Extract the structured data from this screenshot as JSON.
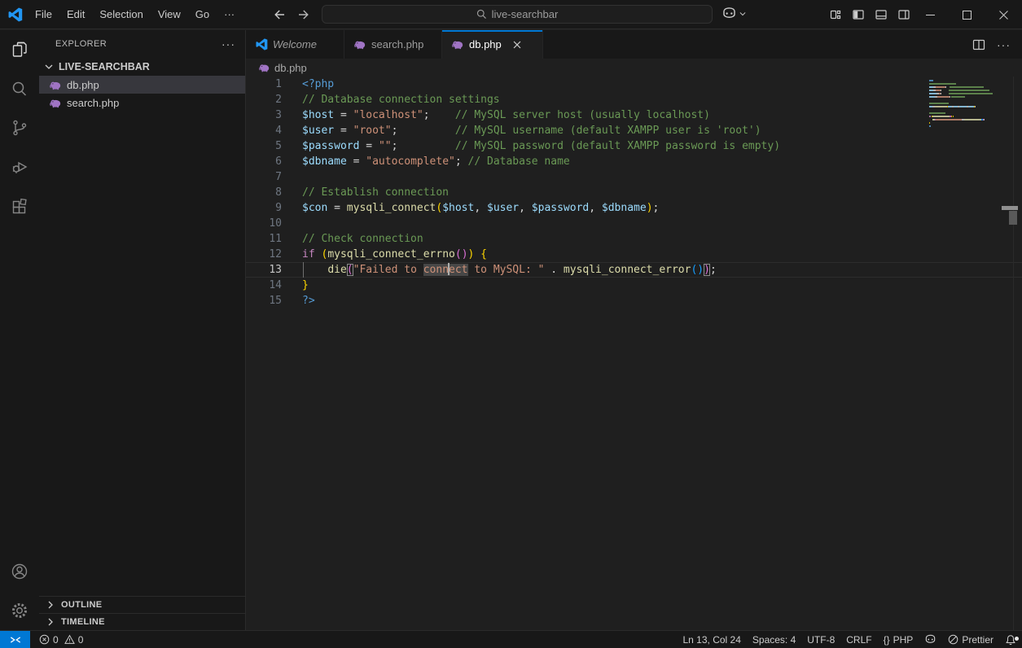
{
  "title_bar": {
    "menus": [
      "File",
      "Edit",
      "Selection",
      "View",
      "Go",
      "···"
    ],
    "command_center": "live-searchbar",
    "icons": {
      "logo": "vscode-logo",
      "back": "arrow-left",
      "forward": "arrow-right",
      "search": "magnifier",
      "copilot": "copilot-face",
      "chevron": "chevron-down",
      "layout": [
        "customize-layout",
        "toggle-primary-sidebar",
        "toggle-panel",
        "toggle-secondary-sidebar"
      ],
      "window": [
        "minimize",
        "maximize",
        "close"
      ]
    }
  },
  "activity_bar": {
    "items": [
      {
        "name": "explorer",
        "active": true
      },
      {
        "name": "search",
        "active": false
      },
      {
        "name": "source-control",
        "active": false
      },
      {
        "name": "run-and-debug",
        "active": false
      },
      {
        "name": "extensions",
        "active": false
      },
      {
        "name": "accounts",
        "active": false
      },
      {
        "name": "settings",
        "active": false
      }
    ]
  },
  "sidebar": {
    "header": "EXPLORER",
    "more": "···",
    "folder": "LIVE-SEARCHBAR",
    "files": [
      {
        "name": "db.php",
        "selected": true
      },
      {
        "name": "search.php",
        "selected": false
      }
    ],
    "sections": [
      "OUTLINE",
      "TIMELINE"
    ]
  },
  "editor": {
    "tabs": [
      {
        "label": "Welcome",
        "icon": "vscode",
        "italic": true,
        "active": false
      },
      {
        "label": "search.php",
        "icon": "php",
        "italic": false,
        "active": false
      },
      {
        "label": "db.php",
        "icon": "php",
        "italic": false,
        "active": true
      }
    ],
    "breadcrumb": "db.php",
    "code": {
      "language": "php",
      "lines": [
        {
          "tokens": [
            {
              "t": "<?php",
              "c": "tag"
            }
          ]
        },
        {
          "tokens": [
            {
              "t": "// Database connection settings",
              "c": "cm"
            }
          ]
        },
        {
          "tokens": [
            {
              "t": "$host",
              "c": "v"
            },
            {
              "t": " = ",
              "c": "d"
            },
            {
              "t": "\"localhost\"",
              "c": "s"
            },
            {
              "t": ";",
              "c": "d"
            },
            {
              "t": "    ",
              "c": "d"
            },
            {
              "t": "// MySQL server host (usually localhost)",
              "c": "cm"
            }
          ]
        },
        {
          "tokens": [
            {
              "t": "$user",
              "c": "v"
            },
            {
              "t": " = ",
              "c": "d"
            },
            {
              "t": "\"root\"",
              "c": "s"
            },
            {
              "t": ";",
              "c": "d"
            },
            {
              "t": "         ",
              "c": "d"
            },
            {
              "t": "// MySQL username (default XAMPP user is 'root')",
              "c": "cm"
            }
          ]
        },
        {
          "tokens": [
            {
              "t": "$password",
              "c": "v"
            },
            {
              "t": " = ",
              "c": "d"
            },
            {
              "t": "\"\"",
              "c": "s"
            },
            {
              "t": ";",
              "c": "d"
            },
            {
              "t": "         ",
              "c": "d"
            },
            {
              "t": "// MySQL password (default XAMPP password is empty)",
              "c": "cm"
            }
          ]
        },
        {
          "tokens": [
            {
              "t": "$dbname",
              "c": "v"
            },
            {
              "t": " = ",
              "c": "d"
            },
            {
              "t": "\"autocomplete\"",
              "c": "s"
            },
            {
              "t": ";",
              "c": "d"
            },
            {
              "t": " ",
              "c": "d"
            },
            {
              "t": "// Database name",
              "c": "cm"
            }
          ]
        },
        {
          "tokens": []
        },
        {
          "tokens": [
            {
              "t": "// Establish connection",
              "c": "cm"
            }
          ]
        },
        {
          "tokens": [
            {
              "t": "$con",
              "c": "v"
            },
            {
              "t": " = ",
              "c": "d"
            },
            {
              "t": "mysqli_connect",
              "c": "f"
            },
            {
              "t": "(",
              "c": "b1"
            },
            {
              "t": "$host",
              "c": "v"
            },
            {
              "t": ", ",
              "c": "d"
            },
            {
              "t": "$user",
              "c": "v"
            },
            {
              "t": ", ",
              "c": "d"
            },
            {
              "t": "$password",
              "c": "v"
            },
            {
              "t": ", ",
              "c": "d"
            },
            {
              "t": "$dbname",
              "c": "v"
            },
            {
              "t": ")",
              "c": "b1"
            },
            {
              "t": ";",
              "c": "d"
            }
          ]
        },
        {
          "tokens": []
        },
        {
          "tokens": [
            {
              "t": "// Check connection",
              "c": "cm"
            }
          ]
        },
        {
          "tokens": [
            {
              "t": "if",
              "c": "k"
            },
            {
              "t": " ",
              "c": "d"
            },
            {
              "t": "(",
              "c": "b1"
            },
            {
              "t": "mysqli_connect_errno",
              "c": "f"
            },
            {
              "t": "(",
              "c": "b2"
            },
            {
              "t": ")",
              "c": "b2"
            },
            {
              "t": ")",
              "c": "b1"
            },
            {
              "t": " ",
              "c": "d"
            },
            {
              "t": "{",
              "c": "b1"
            }
          ]
        },
        {
          "current": true,
          "guide": true,
          "tokens": [
            {
              "t": "    ",
              "c": "d"
            },
            {
              "t": "die",
              "c": "f"
            },
            {
              "t": "(",
              "c": "b2",
              "m": true
            },
            {
              "t": "\"Failed to ",
              "c": "s"
            },
            {
              "t": "conn",
              "c": "s",
              "hl": true
            },
            {
              "cursor": true
            },
            {
              "t": "ect",
              "c": "s",
              "hl": true
            },
            {
              "t": " to MySQL: \"",
              "c": "s"
            },
            {
              "t": " . ",
              "c": "d"
            },
            {
              "t": "mysqli_connect_error",
              "c": "f"
            },
            {
              "t": "(",
              "c": "b3"
            },
            {
              "t": ")",
              "c": "b3"
            },
            {
              "t": ")",
              "c": "b2",
              "m": true
            },
            {
              "t": ";",
              "c": "d"
            }
          ]
        },
        {
          "tokens": [
            {
              "t": "}",
              "c": "b1"
            }
          ]
        },
        {
          "tokens": [
            {
              "t": "?>",
              "c": "tag"
            }
          ]
        }
      ]
    },
    "minimap": true
  },
  "status_bar": {
    "errors": "0",
    "warnings": "0",
    "cursor_position": "Ln 13, Col 24",
    "indentation": "Spaces: 4",
    "encoding": "UTF-8",
    "eol": "CRLF",
    "language_prefix": "{}",
    "language": "PHP",
    "formatter": "Prettier"
  },
  "colors": {
    "accent": "#0078d4",
    "php_icon": "#a074c4",
    "tokens": {
      "tag": "#569CD6",
      "cm": "#6A9955",
      "v": "#9CDCFE",
      "d": "#D4D4D4",
      "s": "#CE9178",
      "f": "#DCDCAA",
      "k": "#C586C0",
      "b1": "#FFD700",
      "b2": "#DA70D6",
      "b3": "#179FFF"
    }
  }
}
